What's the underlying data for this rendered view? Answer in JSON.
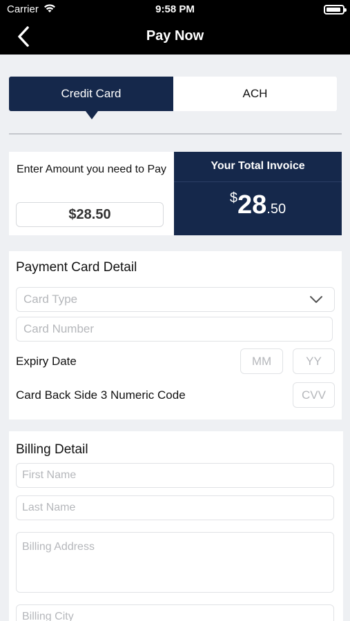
{
  "status_bar": {
    "carrier": "Carrier",
    "time": "9:58 PM",
    "battery_level": 0.9
  },
  "nav": {
    "title": "Pay Now"
  },
  "tabs": [
    {
      "label": "Credit Card",
      "active": true
    },
    {
      "label": "ACH",
      "active": false
    }
  ],
  "amount": {
    "label": "Enter Amount you need to Pay",
    "value": "$28.50"
  },
  "invoice": {
    "title": "Your Total Invoice",
    "currency": "$",
    "whole": "28",
    "decimal": ".50"
  },
  "card_detail": {
    "title": "Payment Card Detail",
    "card_type_placeholder": "Card Type",
    "card_number_placeholder": "Card Number",
    "expiry_label": "Expiry Date",
    "month_placeholder": "MM",
    "year_placeholder": "YY",
    "cvv_label": "Card Back Side 3 Numeric Code",
    "cvv_placeholder": "CVV"
  },
  "billing": {
    "title": "Billing Detail",
    "first_name_placeholder": "First Name",
    "last_name_placeholder": "Last Name",
    "address_placeholder": "Billing Address",
    "city_placeholder": "Billing City"
  },
  "colors": {
    "navy": "#15284b",
    "background": "#eef0f3",
    "placeholder": "#b5b7bb"
  },
  "icons": [
    "wifi-icon",
    "battery-icon",
    "back-chevron-icon",
    "chevron-down-icon"
  ]
}
